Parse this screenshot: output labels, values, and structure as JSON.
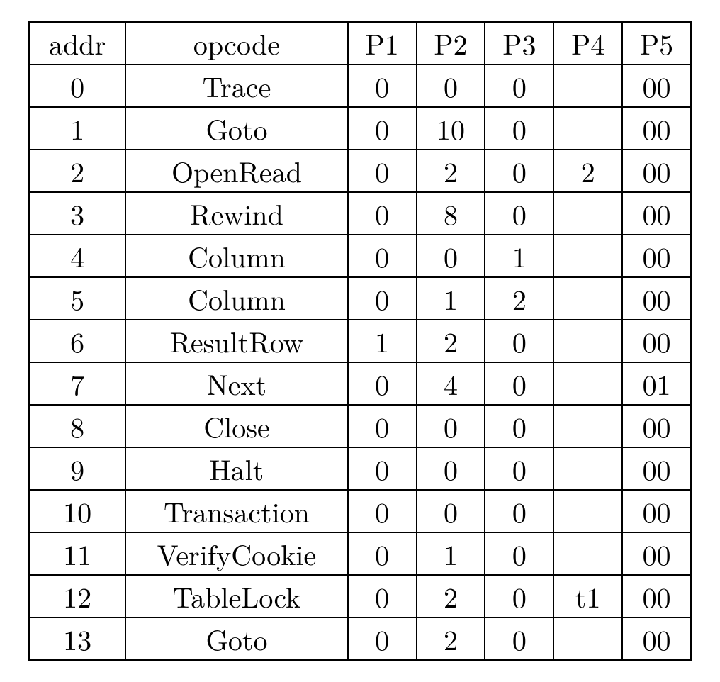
{
  "table": {
    "headers": [
      "addr",
      "opcode",
      "P1",
      "P2",
      "P3",
      "P4",
      "P5"
    ],
    "rows": [
      {
        "addr": "0",
        "opcode": "Trace",
        "p1": "0",
        "p2": "0",
        "p3": "0",
        "p4": "",
        "p5": "00"
      },
      {
        "addr": "1",
        "opcode": "Goto",
        "p1": "0",
        "p2": "10",
        "p3": "0",
        "p4": "",
        "p5": "00"
      },
      {
        "addr": "2",
        "opcode": "OpenRead",
        "p1": "0",
        "p2": "2",
        "p3": "0",
        "p4": "2",
        "p5": "00"
      },
      {
        "addr": "3",
        "opcode": "Rewind",
        "p1": "0",
        "p2": "8",
        "p3": "0",
        "p4": "",
        "p5": "00"
      },
      {
        "addr": "4",
        "opcode": "Column",
        "p1": "0",
        "p2": "0",
        "p3": "1",
        "p4": "",
        "p5": "00"
      },
      {
        "addr": "5",
        "opcode": "Column",
        "p1": "0",
        "p2": "1",
        "p3": "2",
        "p4": "",
        "p5": "00"
      },
      {
        "addr": "6",
        "opcode": "ResultRow",
        "p1": "1",
        "p2": "2",
        "p3": "0",
        "p4": "",
        "p5": "00"
      },
      {
        "addr": "7",
        "opcode": "Next",
        "p1": "0",
        "p2": "4",
        "p3": "0",
        "p4": "",
        "p5": "01"
      },
      {
        "addr": "8",
        "opcode": "Close",
        "p1": "0",
        "p2": "0",
        "p3": "0",
        "p4": "",
        "p5": "00"
      },
      {
        "addr": "9",
        "opcode": "Halt",
        "p1": "0",
        "p2": "0",
        "p3": "0",
        "p4": "",
        "p5": "00"
      },
      {
        "addr": "10",
        "opcode": "Transaction",
        "p1": "0",
        "p2": "0",
        "p3": "0",
        "p4": "",
        "p5": "00"
      },
      {
        "addr": "11",
        "opcode": "VerifyCookie",
        "p1": "0",
        "p2": "1",
        "p3": "0",
        "p4": "",
        "p5": "00"
      },
      {
        "addr": "12",
        "opcode": "TableLock",
        "p1": "0",
        "p2": "2",
        "p3": "0",
        "p4": "t1",
        "p5": "00"
      },
      {
        "addr": "13",
        "opcode": "Goto",
        "p1": "0",
        "p2": "2",
        "p3": "0",
        "p4": "",
        "p5": "00"
      }
    ]
  }
}
